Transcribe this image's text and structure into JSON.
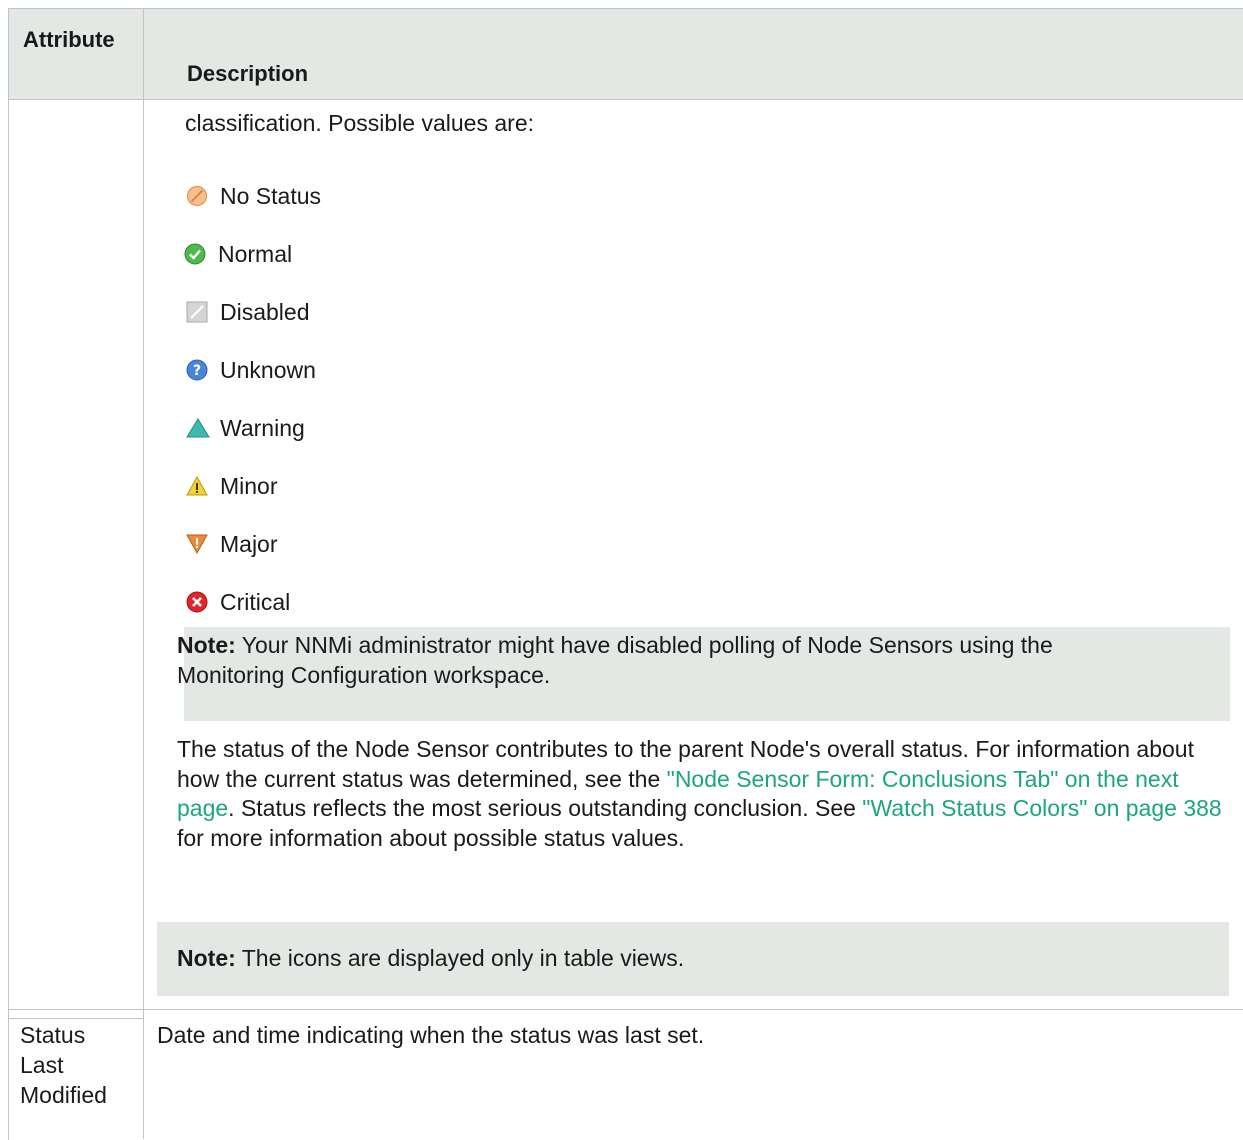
{
  "headers": {
    "attribute": "Attribute",
    "description": "Description"
  },
  "status_row": {
    "intro": "classification. Possible values are:",
    "statuses": [
      {
        "label": "No Status",
        "icon": "no-status-icon"
      },
      {
        "label": "Normal",
        "icon": "normal-icon"
      },
      {
        "label": "Disabled",
        "icon": "disabled-icon"
      },
      {
        "label": "Unknown",
        "icon": "unknown-icon"
      },
      {
        "label": "Warning",
        "icon": "warning-icon"
      },
      {
        "label": "Minor",
        "icon": "minor-icon"
      },
      {
        "label": "Major",
        "icon": "major-icon"
      },
      {
        "label": "Critical",
        "icon": "critical-icon"
      }
    ],
    "note1": {
      "label": "Note:",
      "line1": " Your NNMi administrator might have disabled polling of Node Sensors using the",
      "line2": "Monitoring Configuration workspace."
    },
    "para": {
      "p1": "The status of the Node Sensor contributes to the parent Node's overall status. For information about how the current status was determined, see the ",
      "link1": "\"Node Sensor Form: Conclusions Tab\" on the next page",
      "p2": ". Status reflects the most serious outstanding conclusion. See ",
      "link2": "\"Watch Status Colors\" on page 388",
      "p3": " for more information about possible status values."
    },
    "note2": {
      "label": "Note:",
      "text": " The icons are displayed only in table views."
    }
  },
  "last_modified_row": {
    "attribute": "Status Last Modified",
    "description": "Date and time indicating when the status was last set."
  }
}
